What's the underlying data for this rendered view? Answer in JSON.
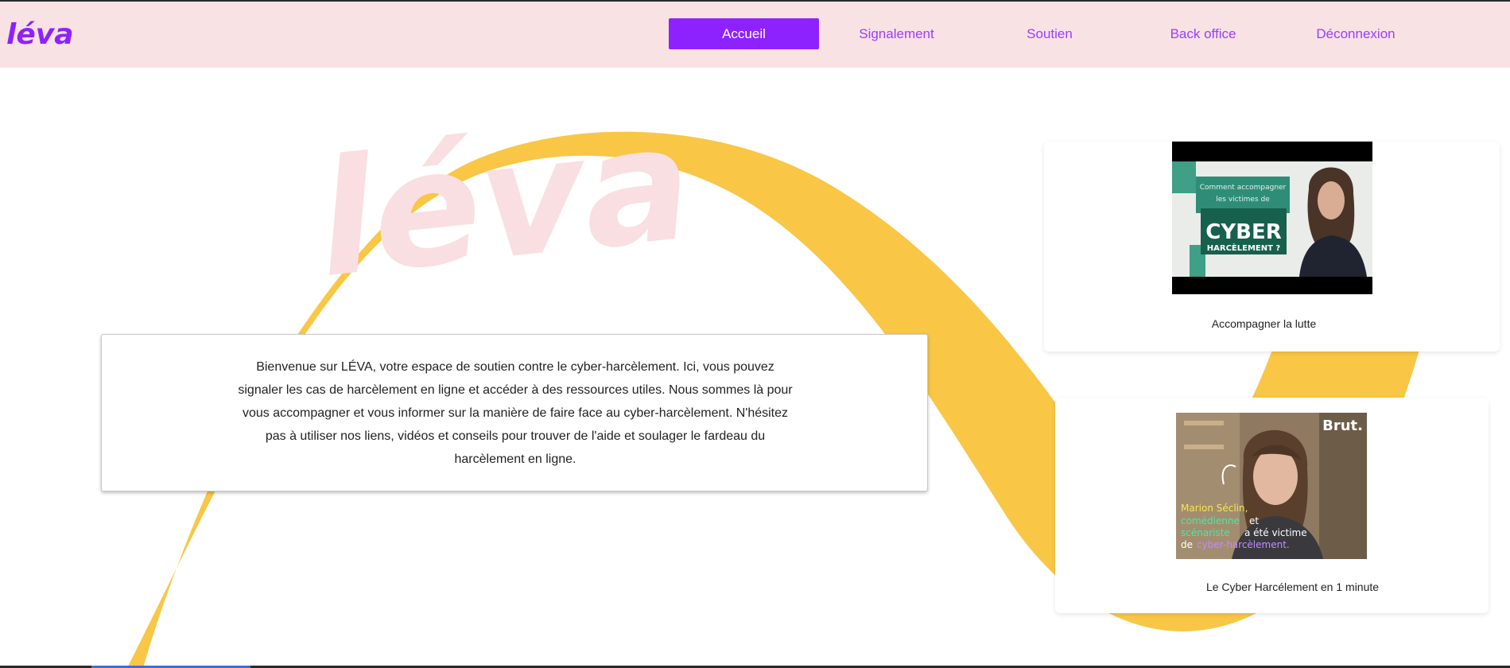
{
  "header": {
    "logo_text": "léva",
    "nav": [
      {
        "label": "Accueil",
        "active": true
      },
      {
        "label": "Signalement",
        "active": false
      },
      {
        "label": "Soutien",
        "active": false
      },
      {
        "label": "Back office",
        "active": false
      },
      {
        "label": "Déconnexion",
        "active": false
      }
    ]
  },
  "hero": {
    "watermark_text": "léva",
    "welcome_text": "Bienvenue sur LÉVA, votre espace de soutien contre le cyber-harcèlement. Ici, vous pouvez signaler les cas de harcèlement en ligne et accéder à des ressources utiles. Nous sommes là pour vous accompagner et vous informer sur la manière de faire face au cyber-harcèlement. N'hésitez pas à utiliser nos liens, vidéos et conseils pour trouver de l'aide et soulager le fardeau du harcèlement en ligne."
  },
  "videos": [
    {
      "title": "Accompagner la lutte",
      "thumb_text": {
        "line1": "Comment accompagner",
        "line2": "les victimes de",
        "big": "CYBER",
        "small": "HARCÈLEMENT ?"
      }
    },
    {
      "title": "Le Cyber Harcélement en 1 minute",
      "thumb_text": {
        "brand": "Brut.",
        "name": "Marion Séclin,",
        "line1": "comédienne",
        "and": "et",
        "line2": "scénariste",
        "rest": "a été victime",
        "line3": "de",
        "line4": "cyber-harcèlement."
      }
    }
  ],
  "colors": {
    "header_bg": "#f9e2e4",
    "accent": "#8e22ff",
    "nav_text": "#9a3dff",
    "ribbon": "#f9c646",
    "watermark": "#f9dfe1"
  }
}
